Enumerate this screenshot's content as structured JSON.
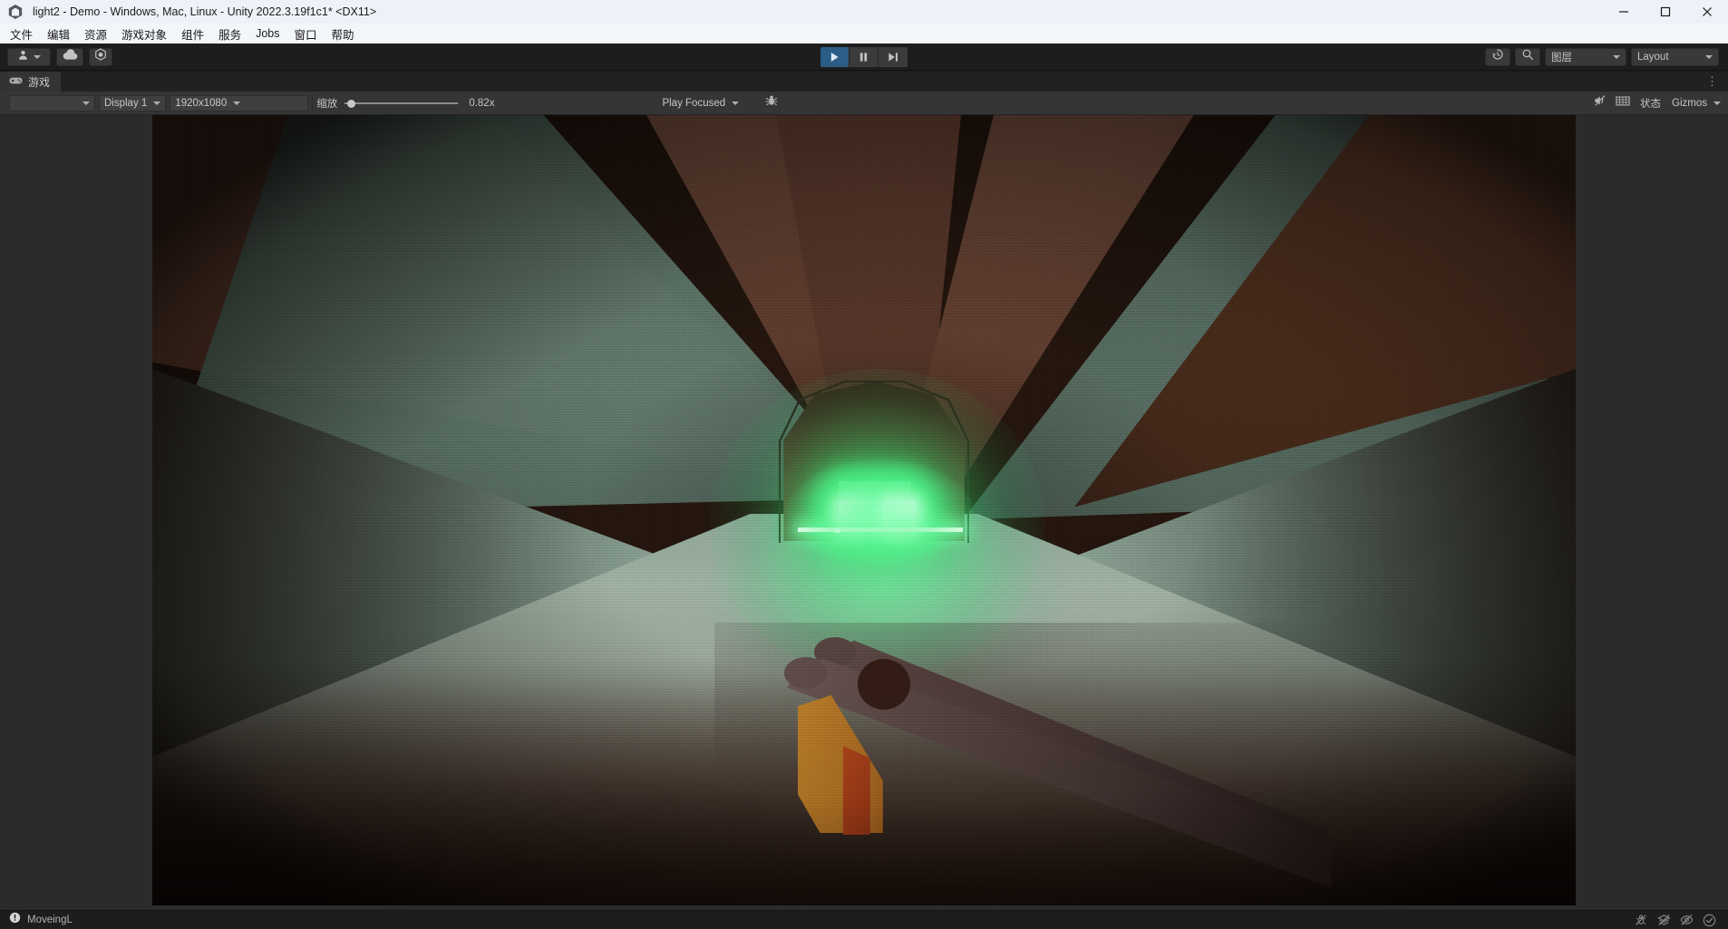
{
  "window": {
    "title": "light2 - Demo - Windows, Mac, Linux - Unity 2022.3.19f1c1* <DX11>",
    "app_icon": "unity-logo-icon",
    "minimize_label": "Minimize",
    "maximize_label": "Maximize",
    "close_label": "Close"
  },
  "menubar": {
    "items": [
      {
        "label": "文件"
      },
      {
        "label": "编辑"
      },
      {
        "label": "资源"
      },
      {
        "label": "游戏对象"
      },
      {
        "label": "组件"
      },
      {
        "label": "服务"
      },
      {
        "label": "Jobs"
      },
      {
        "label": "窗口"
      },
      {
        "label": "帮助"
      }
    ]
  },
  "toolbar": {
    "account_icon": "account-avatar-icon",
    "account_caret_icon": "chevron-down-icon",
    "cloud_icon": "cloud-icon",
    "unity_services_icon": "unity-settings-icon",
    "play_label": "Play",
    "play_icon": "play-icon",
    "pause_label": "Pause",
    "pause_icon": "pause-icon",
    "step_label": "Step",
    "step_icon": "step-forward-icon",
    "undo_history_icon": "history-icon",
    "search_icon": "search-icon",
    "layers_label": "图层",
    "layers_caret_icon": "chevron-down-icon",
    "layout_label": "Layout",
    "layout_caret_icon": "chevron-down-icon"
  },
  "game_panel": {
    "tab_label": "游戏",
    "tab_icon": "gamepad-icon",
    "more_menu_icon": "kebab-menu-icon",
    "toolbar": {
      "aspect_caret_icon": "chevron-down-icon",
      "display_label": "Display 1",
      "display_caret_icon": "chevron-down-icon",
      "resolution_label": "1920x1080",
      "resolution_caret_icon": "chevron-down-icon",
      "zoom_label": "缩放",
      "zoom_value": "0.82x",
      "zoom_slider_percent": 2,
      "play_mode_label": "Play Focused",
      "play_mode_caret_icon": "chevron-down-icon",
      "debug_icon": "bug-icon",
      "mute_audio_icon": "mute-audio-icon",
      "aspect_grid_icon": "frame-debugger-icon",
      "stats_label": "状态",
      "gizmos_label": "Gizmos",
      "gizmos_caret_icon": "chevron-down-icon"
    }
  },
  "scene": {
    "description": "First-person view down a faceted tunnel toward a glowing green vehicle with two bright headlights; a double-barrel weapon with an orange magazine is held in the lower right foreground.",
    "colors": {
      "tunnel_warm": "#6b3c2b",
      "tunnel_cool": "#8fae9f",
      "floor": "#9aa89e",
      "headlight_glow": "#3bf06a",
      "weapon_body": "#5b4a48",
      "weapon_magazine": "#e2952e",
      "weapon_magazine_dark": "#c0451c"
    }
  },
  "statusbar": {
    "message_icon": "error-info-icon",
    "message": "MoveingL",
    "icons": [
      {
        "name": "bug-disabled-icon"
      },
      {
        "name": "layers-disabled-icon"
      },
      {
        "name": "preview-disabled-icon"
      },
      {
        "name": "check-circle-icon"
      }
    ]
  }
}
